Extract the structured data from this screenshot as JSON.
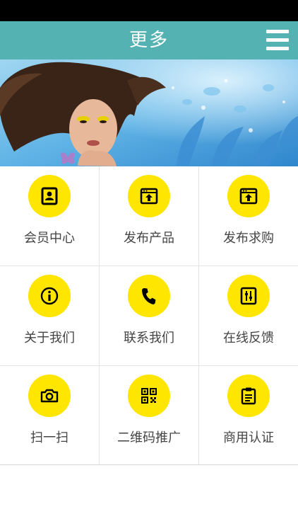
{
  "header": {
    "title": "更多",
    "menu_icon": "hamburger-menu-icon"
  },
  "colors": {
    "header_bg": "#55b2b2",
    "icon_circle": "#ffe600",
    "icon_glyph": "#000000",
    "label_text": "#444444",
    "status_bar": "#000000"
  },
  "grid": {
    "items": [
      {
        "label": "会员中心",
        "icon": "member-card-icon"
      },
      {
        "label": "发布产品",
        "icon": "upload-window-icon"
      },
      {
        "label": "发布求购",
        "icon": "upload-window-icon"
      },
      {
        "label": "关于我们",
        "icon": "info-circle-icon"
      },
      {
        "label": "联系我们",
        "icon": "phone-icon"
      },
      {
        "label": "在线反馈",
        "icon": "sliders-icon"
      },
      {
        "label": "扫一扫",
        "icon": "camera-icon"
      },
      {
        "label": "二维码推广",
        "icon": "qr-code-icon"
      },
      {
        "label": "商用认证",
        "icon": "clipboard-icon"
      }
    ]
  }
}
